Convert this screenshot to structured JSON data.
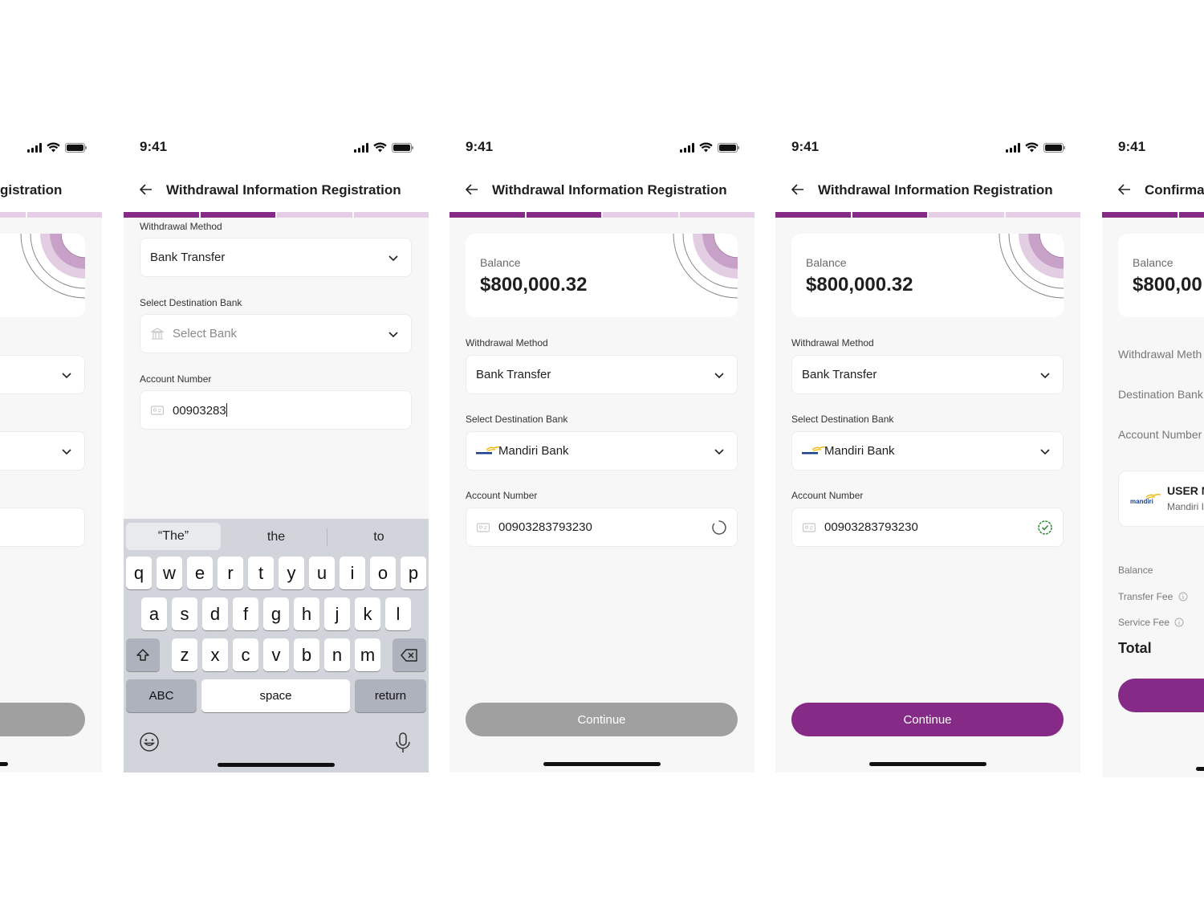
{
  "status": {
    "time": "9:41"
  },
  "header": {
    "title": "Withdrawal Information Registration",
    "confirm_title": "Confirmat"
  },
  "left_clip": {
    "title_fragment": "gistration"
  },
  "labels": {
    "withdrawal_method": "Withdrawal Method",
    "destination_bank": "Select Destination Bank",
    "account_number": "Account Number"
  },
  "balance": {
    "label": "Balance",
    "amount": "$800,000.32",
    "amount_fragment": "$800,00"
  },
  "values": {
    "method": "Bank Transfer",
    "bank_placeholder": "Select Bank",
    "bank_name": "Mandiri Bank",
    "account_typing": "00903283",
    "account_full": "00903283793230"
  },
  "buttons": {
    "continue": "Continue"
  },
  "keyboard": {
    "suggestions": [
      "“The”",
      "the",
      "to"
    ],
    "row1": [
      "q",
      "w",
      "e",
      "r",
      "t",
      "y",
      "u",
      "i",
      "o",
      "p"
    ],
    "row2": [
      "a",
      "s",
      "d",
      "f",
      "g",
      "h",
      "j",
      "k",
      "l"
    ],
    "row3": [
      "z",
      "x",
      "c",
      "v",
      "b",
      "n",
      "m"
    ],
    "abc": "ABC",
    "space": "space",
    "return": "return"
  },
  "confirmation": {
    "withdrawal_method": "Withdrawal Meth",
    "destination_bank": "Destination Bank",
    "account_number": "Account Number",
    "user_name": "USER N",
    "bank_fragment": "Mandiri I",
    "logo_text": "mandiri",
    "balance": "Balance",
    "transfer_fee": "Transfer Fee",
    "service_fee": "Service Fee",
    "total": "Total"
  },
  "colors": {
    "primary": "#862a88",
    "progress_inactive": "#e6cfe6",
    "disabled": "#a0a0a0",
    "success": "#2e8b3a"
  }
}
